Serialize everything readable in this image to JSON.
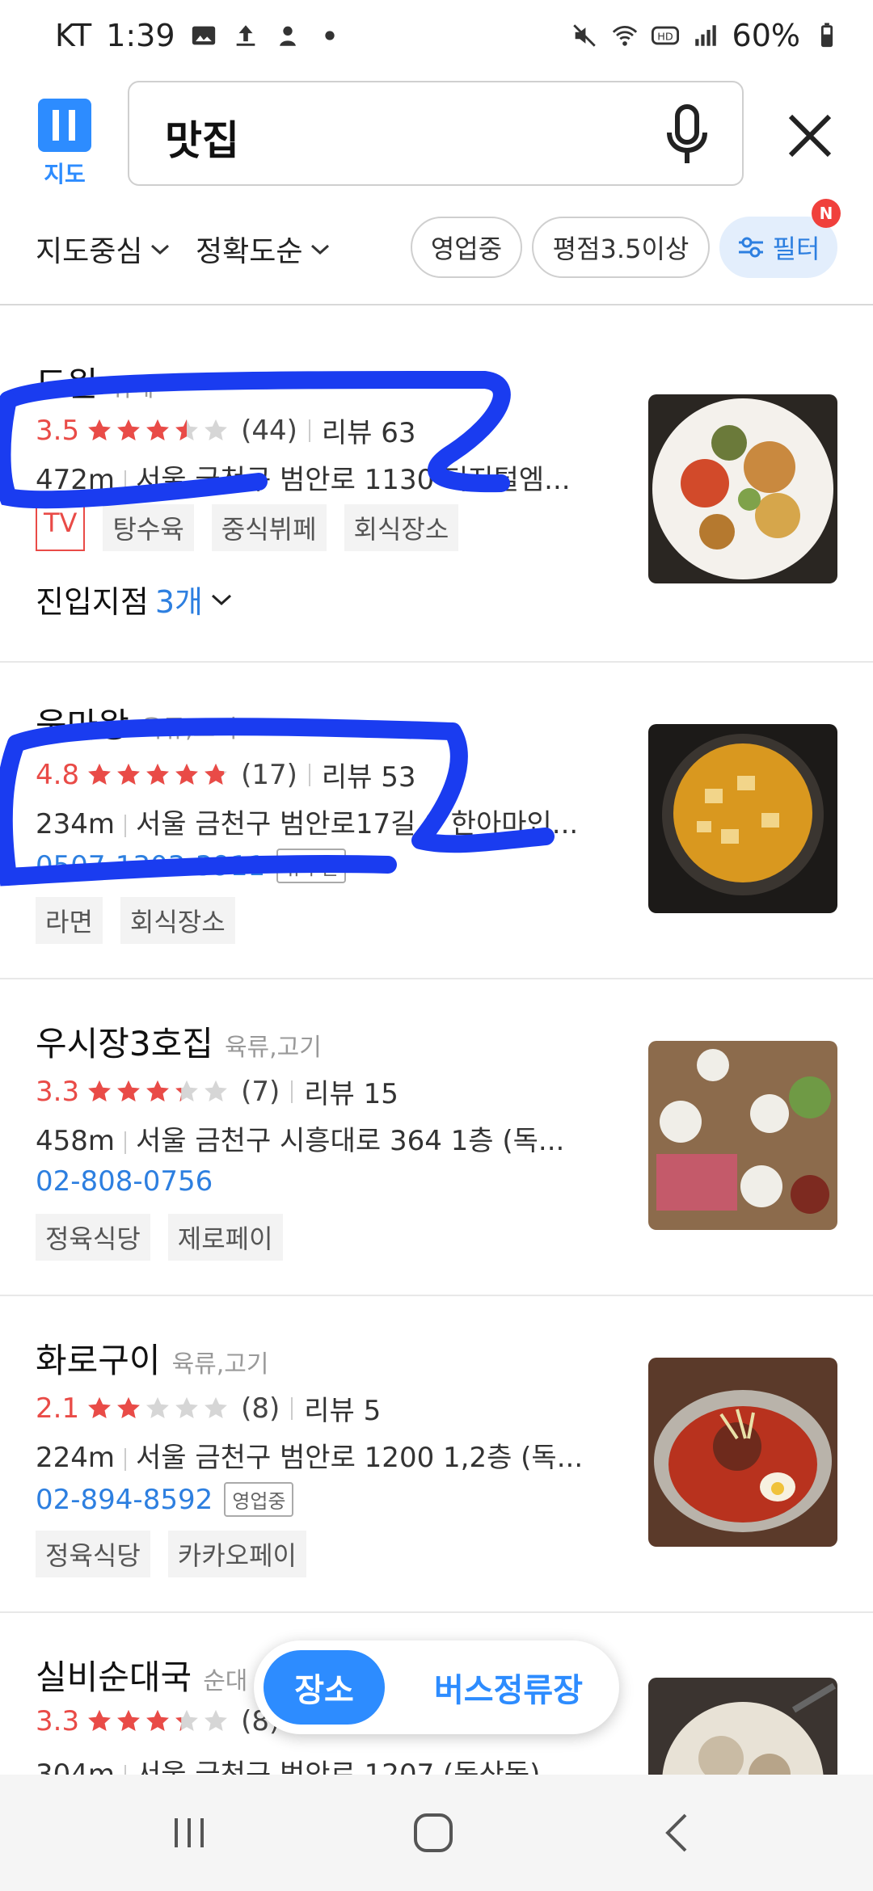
{
  "status_bar": {
    "carrier": "KT",
    "time": "1:39",
    "battery": "60%",
    "left_icons": [
      "gallery-icon",
      "upload-icon",
      "app-icon",
      "dot-icon"
    ],
    "right_icons": [
      "mute-icon",
      "wifi-icon",
      "hd-icon",
      "signal-icon",
      "battery-icon"
    ]
  },
  "header": {
    "logo_label": "지도",
    "search_query": "맛집"
  },
  "filters": {
    "sort1": "지도중심",
    "sort2": "정확도순",
    "chips": [
      "영업중",
      "평점3.5이상"
    ],
    "filter_label": "필터",
    "new_badge": "N"
  },
  "places": [
    {
      "name": "도원",
      "category": "뷔페",
      "score": "3.5",
      "rating": 3.5,
      "count": "(44)",
      "review": "리뷰 63",
      "distance": "472m",
      "address": "서울 금천구 범안로 1130 디지털엠...",
      "tags": [
        "TV",
        "탕수육",
        "중식뷔페",
        "회식장소"
      ],
      "branch_label": "진입지점",
      "branch_count": "3개"
    },
    {
      "name": "움마왕",
      "category": "육류,고기",
      "score": "4.8",
      "rating": 4.8,
      "count": "(17)",
      "review": "리뷰 53",
      "distance": "234m",
      "address": "서울 금천구 범안로17길 9 한아마인...",
      "phone": "0507-1303-3911",
      "phone_badge": "유무필",
      "tags": [
        "라면",
        "회식장소"
      ]
    },
    {
      "name": "우시장3호집",
      "category": "육류,고기",
      "score": "3.3",
      "rating": 3.3,
      "count": "(7)",
      "review": "리뷰 15",
      "distance": "458m",
      "address": "서울 금천구 시흥대로 364 1층 (독...",
      "phone": "02-808-0756",
      "tags": [
        "정육식당",
        "제로페이"
      ]
    },
    {
      "name": "화로구이",
      "category": "육류,고기",
      "score": "2.1",
      "rating": 2.1,
      "count": "(8)",
      "review": "리뷰 5",
      "distance": "224m",
      "address": "서울 금천구 범안로 1200 1,2층 (독...",
      "phone": "02-894-8592",
      "phone_badge": "영업중",
      "tags": [
        "정육식당",
        "카카오페이"
      ]
    },
    {
      "name": "실비순대국",
      "category": "순대",
      "score": "3.3",
      "rating": 3.3,
      "count": "(8)",
      "review": "",
      "distance": "304m",
      "address": "서울 금천구 범안로 1207 (독산동)"
    }
  ],
  "toggle": {
    "active": "장소",
    "inactive": "버스정류장"
  },
  "colors": {
    "accent": "#2d8cff",
    "rating_red": "#e94b47",
    "link_blue": "#2d7fe0",
    "scribble": "#1a3cf0"
  }
}
